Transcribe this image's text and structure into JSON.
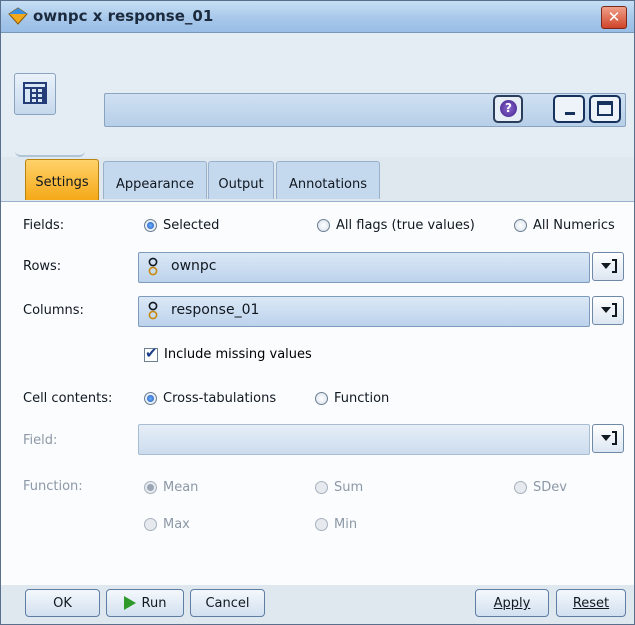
{
  "window": {
    "title": "ownpc x response_01",
    "close_glyph": "✕",
    "help_glyph": "?"
  },
  "tabs": [
    {
      "label": "Settings",
      "active": true
    },
    {
      "label": "Appearance",
      "active": false
    },
    {
      "label": "Output",
      "active": false
    },
    {
      "label": "Annotations",
      "active": false
    }
  ],
  "settings": {
    "fields_label": "Fields:",
    "fields_options": [
      {
        "label": "Selected",
        "selected": true
      },
      {
        "label": "All flags (true values)",
        "selected": false
      },
      {
        "label": "All Numerics",
        "selected": false
      }
    ],
    "rows_label": "Rows:",
    "rows_value": "ownpc",
    "columns_label": "Columns:",
    "columns_value": "response_01",
    "include_missing_label": "Include missing values",
    "include_missing_checked": true,
    "cell_contents_label": "Cell contents:",
    "cell_contents_options": [
      {
        "label": "Cross-tabulations",
        "selected": true
      },
      {
        "label": "Function",
        "selected": false
      }
    ],
    "field_label": "Field:",
    "field_value": "",
    "function_label": "Function:",
    "function_options": [
      {
        "label": "Mean",
        "selected": true
      },
      {
        "label": "Sum",
        "selected": false
      },
      {
        "label": "SDev",
        "selected": false
      },
      {
        "label": "Max",
        "selected": false
      },
      {
        "label": "Min",
        "selected": false
      }
    ]
  },
  "buttons": {
    "ok": "OK",
    "run": "Run",
    "cancel": "Cancel",
    "apply": "Apply",
    "reset": "Reset"
  },
  "icons": {
    "title": "diamond-node-icon",
    "node": "table-matrix-icon",
    "field_type": "flag-field-icon",
    "picker": "field-picker-icon"
  },
  "colors": {
    "active_tab": "#f5a818",
    "title_bar": "#a8c8ea",
    "close": "#d04428",
    "run_play": "#2f9a2a"
  }
}
